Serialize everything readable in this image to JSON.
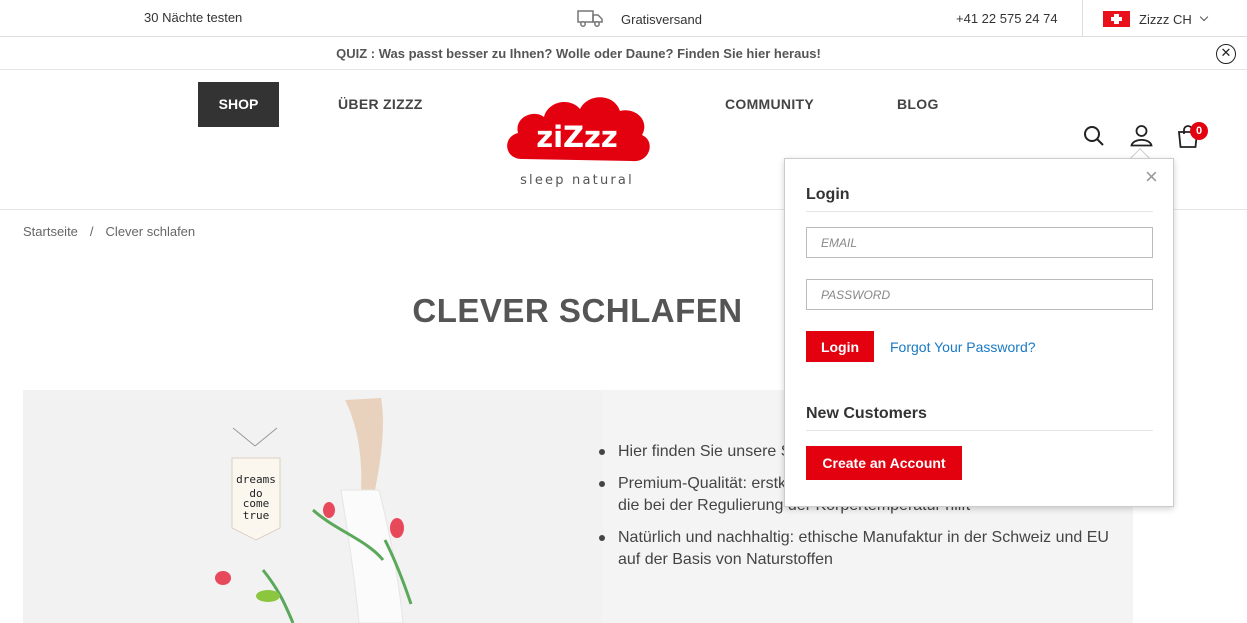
{
  "topbar": {
    "nights": "30 Nächte testen",
    "shipping": "Gratisversand",
    "phone": "+41 22 575 24 74",
    "region": "Zizzz CH"
  },
  "quiz": {
    "text": "QUIZ : Was passt besser zu Ihnen? Wolle oder Daune? Finden Sie hier heraus!",
    "close": "✕"
  },
  "header": {
    "shop": "SHOP",
    "nav": [
      "ÜBER ZIZZZ",
      "COMMUNITY",
      "BLOG"
    ],
    "logo_text": "ziZzz",
    "logo_sub": "sleep natural",
    "cart_count": "0",
    "brand_color": "#e3000f"
  },
  "breadcrumb": {
    "home": "Startseite",
    "separator": "/",
    "current": "Clever schlafen"
  },
  "page": {
    "title": "CLEVER SCHLAFEN",
    "bullets": [
      "Hier finden Sie unsere Schlafsäcke, Duvets, Ki",
      "Premium-Qualität: erstklassige Bio-Baumwolle mit Swisswool Füllung, die bei der Regulierung der Körpertemperatur hilft",
      "Natürlich und nachhaltig: ethische Manufaktur in der Schweiz und EU auf der Basis von Naturstoffen"
    ],
    "banner_text": [
      "dreams",
      "do",
      "come",
      "true"
    ]
  },
  "login_popup": {
    "login_heading": "Login",
    "email_placeholder": "EMAIL",
    "password_placeholder": "PASSWORD",
    "login_button": "Login",
    "forgot": "Forgot Your Password?",
    "new_customers_heading": "New Customers",
    "create_account": "Create an Account",
    "close": "×"
  }
}
